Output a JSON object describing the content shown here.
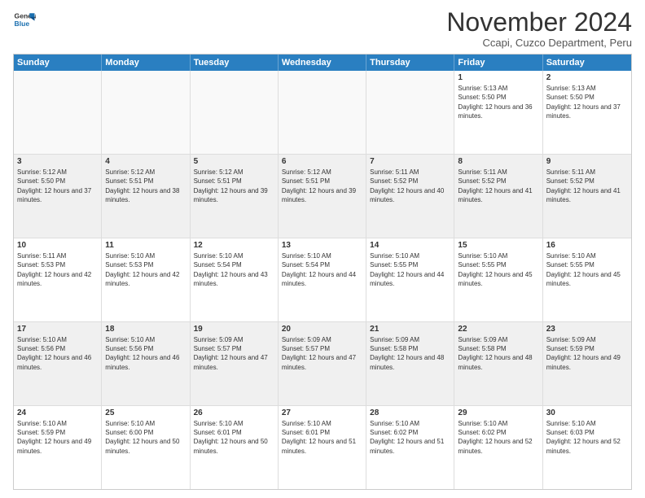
{
  "logo": {
    "line1": "General",
    "line2": "Blue"
  },
  "title": "November 2024",
  "location": "Ccapi, Cuzco Department, Peru",
  "weekdays": [
    "Sunday",
    "Monday",
    "Tuesday",
    "Wednesday",
    "Thursday",
    "Friday",
    "Saturday"
  ],
  "rows": [
    [
      {
        "day": "",
        "empty": true
      },
      {
        "day": "",
        "empty": true
      },
      {
        "day": "",
        "empty": true
      },
      {
        "day": "",
        "empty": true
      },
      {
        "day": "",
        "empty": true
      },
      {
        "day": "1",
        "text": "Sunrise: 5:13 AM\nSunset: 5:50 PM\nDaylight: 12 hours and 36 minutes."
      },
      {
        "day": "2",
        "text": "Sunrise: 5:13 AM\nSunset: 5:50 PM\nDaylight: 12 hours and 37 minutes."
      }
    ],
    [
      {
        "day": "3",
        "text": "Sunrise: 5:12 AM\nSunset: 5:50 PM\nDaylight: 12 hours and 37 minutes."
      },
      {
        "day": "4",
        "text": "Sunrise: 5:12 AM\nSunset: 5:51 PM\nDaylight: 12 hours and 38 minutes."
      },
      {
        "day": "5",
        "text": "Sunrise: 5:12 AM\nSunset: 5:51 PM\nDaylight: 12 hours and 39 minutes."
      },
      {
        "day": "6",
        "text": "Sunrise: 5:12 AM\nSunset: 5:51 PM\nDaylight: 12 hours and 39 minutes."
      },
      {
        "day": "7",
        "text": "Sunrise: 5:11 AM\nSunset: 5:52 PM\nDaylight: 12 hours and 40 minutes."
      },
      {
        "day": "8",
        "text": "Sunrise: 5:11 AM\nSunset: 5:52 PM\nDaylight: 12 hours and 41 minutes."
      },
      {
        "day": "9",
        "text": "Sunrise: 5:11 AM\nSunset: 5:52 PM\nDaylight: 12 hours and 41 minutes."
      }
    ],
    [
      {
        "day": "10",
        "text": "Sunrise: 5:11 AM\nSunset: 5:53 PM\nDaylight: 12 hours and 42 minutes."
      },
      {
        "day": "11",
        "text": "Sunrise: 5:10 AM\nSunset: 5:53 PM\nDaylight: 12 hours and 42 minutes."
      },
      {
        "day": "12",
        "text": "Sunrise: 5:10 AM\nSunset: 5:54 PM\nDaylight: 12 hours and 43 minutes."
      },
      {
        "day": "13",
        "text": "Sunrise: 5:10 AM\nSunset: 5:54 PM\nDaylight: 12 hours and 44 minutes."
      },
      {
        "day": "14",
        "text": "Sunrise: 5:10 AM\nSunset: 5:55 PM\nDaylight: 12 hours and 44 minutes."
      },
      {
        "day": "15",
        "text": "Sunrise: 5:10 AM\nSunset: 5:55 PM\nDaylight: 12 hours and 45 minutes."
      },
      {
        "day": "16",
        "text": "Sunrise: 5:10 AM\nSunset: 5:55 PM\nDaylight: 12 hours and 45 minutes."
      }
    ],
    [
      {
        "day": "17",
        "text": "Sunrise: 5:10 AM\nSunset: 5:56 PM\nDaylight: 12 hours and 46 minutes."
      },
      {
        "day": "18",
        "text": "Sunrise: 5:10 AM\nSunset: 5:56 PM\nDaylight: 12 hours and 46 minutes."
      },
      {
        "day": "19",
        "text": "Sunrise: 5:09 AM\nSunset: 5:57 PM\nDaylight: 12 hours and 47 minutes."
      },
      {
        "day": "20",
        "text": "Sunrise: 5:09 AM\nSunset: 5:57 PM\nDaylight: 12 hours and 47 minutes."
      },
      {
        "day": "21",
        "text": "Sunrise: 5:09 AM\nSunset: 5:58 PM\nDaylight: 12 hours and 48 minutes."
      },
      {
        "day": "22",
        "text": "Sunrise: 5:09 AM\nSunset: 5:58 PM\nDaylight: 12 hours and 48 minutes."
      },
      {
        "day": "23",
        "text": "Sunrise: 5:09 AM\nSunset: 5:59 PM\nDaylight: 12 hours and 49 minutes."
      }
    ],
    [
      {
        "day": "24",
        "text": "Sunrise: 5:10 AM\nSunset: 5:59 PM\nDaylight: 12 hours and 49 minutes."
      },
      {
        "day": "25",
        "text": "Sunrise: 5:10 AM\nSunset: 6:00 PM\nDaylight: 12 hours and 50 minutes."
      },
      {
        "day": "26",
        "text": "Sunrise: 5:10 AM\nSunset: 6:01 PM\nDaylight: 12 hours and 50 minutes."
      },
      {
        "day": "27",
        "text": "Sunrise: 5:10 AM\nSunset: 6:01 PM\nDaylight: 12 hours and 51 minutes."
      },
      {
        "day": "28",
        "text": "Sunrise: 5:10 AM\nSunset: 6:02 PM\nDaylight: 12 hours and 51 minutes."
      },
      {
        "day": "29",
        "text": "Sunrise: 5:10 AM\nSunset: 6:02 PM\nDaylight: 12 hours and 52 minutes."
      },
      {
        "day": "30",
        "text": "Sunrise: 5:10 AM\nSunset: 6:03 PM\nDaylight: 12 hours and 52 minutes."
      }
    ]
  ]
}
